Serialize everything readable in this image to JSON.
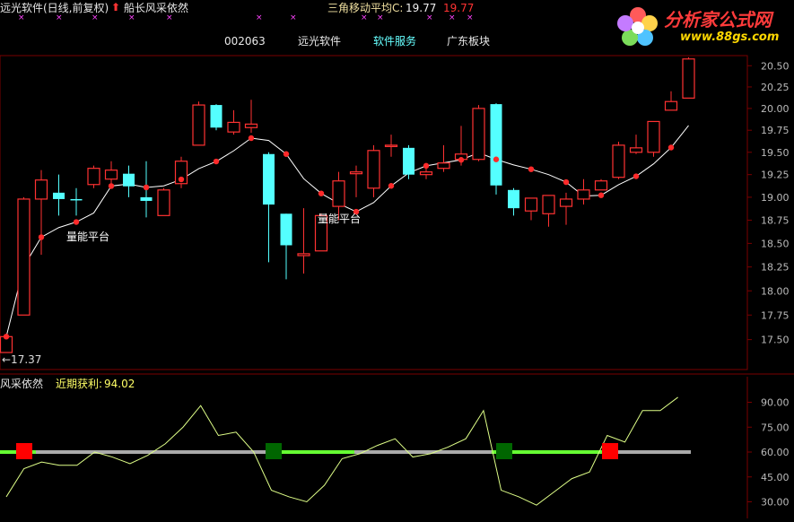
{
  "header": {
    "title": "远光软件(日线,前复权)",
    "indicator_arrow": "up-arrow-icon",
    "indicator": "船长风采依然",
    "tri_label": "三角移动平均C:",
    "tri_value": "19.77",
    "tri_value2": "19.77"
  },
  "info_bar": {
    "code": "002063",
    "name": "远光软件",
    "industry": "软件服务",
    "region": "广东板块"
  },
  "logo": {
    "text": "分析家公式网",
    "url": "www.88gs.com"
  },
  "main_chart": {
    "low_marker": "←17.37",
    "platform_label": "量能平台",
    "y_ticks": [
      "20.50",
      "20.25",
      "20.00",
      "19.75",
      "19.50",
      "19.25",
      "19.00",
      "18.75",
      "18.50",
      "18.25",
      "18.00",
      "17.75",
      "17.50"
    ]
  },
  "sub_chart": {
    "title": "风采依然",
    "metric_label": "近期获利:",
    "metric_value": "94.02",
    "y_ticks": [
      "90.00",
      "75.00",
      "60.00",
      "45.00",
      "30.00"
    ]
  },
  "colors": {
    "up": "#ff3232",
    "down": "#54ffff",
    "ma": "#ffffff",
    "sub_line": "#dfff88",
    "baseline_green": "#66ff33",
    "baseline_gray": "#aaaaaa",
    "grid_red": "#7a0000"
  },
  "chart_data": [
    {
      "type": "candlestick",
      "y_scale": "log",
      "ylim": [
        17.2,
        20.62
      ],
      "candles": [
        {
          "o": 17.37,
          "h": 17.56,
          "l": 17.37,
          "c": 17.53
        },
        {
          "o": 17.75,
          "h": 19.0,
          "l": 17.75,
          "c": 18.98
        },
        {
          "o": 18.98,
          "h": 19.3,
          "l": 18.38,
          "c": 19.19
        },
        {
          "o": 19.05,
          "h": 19.25,
          "l": 18.8,
          "c": 18.98
        },
        {
          "o": 18.98,
          "h": 19.1,
          "l": 18.8,
          "c": 18.97
        },
        {
          "o": 19.14,
          "h": 19.35,
          "l": 19.1,
          "c": 19.32
        },
        {
          "o": 19.2,
          "h": 19.4,
          "l": 19.1,
          "c": 19.3
        },
        {
          "o": 19.26,
          "h": 19.35,
          "l": 19.0,
          "c": 19.12
        },
        {
          "o": 19.0,
          "h": 19.4,
          "l": 18.78,
          "c": 18.96
        },
        {
          "o": 18.8,
          "h": 19.1,
          "l": 18.8,
          "c": 19.08
        },
        {
          "o": 19.15,
          "h": 19.45,
          "l": 19.1,
          "c": 19.4
        },
        {
          "o": 19.58,
          "h": 20.08,
          "l": 19.58,
          "c": 20.04
        },
        {
          "o": 20.04,
          "h": 20.05,
          "l": 19.75,
          "c": 19.78
        },
        {
          "o": 19.73,
          "h": 19.98,
          "l": 19.7,
          "c": 19.84
        },
        {
          "o": 19.78,
          "h": 20.1,
          "l": 19.72,
          "c": 19.82
        },
        {
          "o": 19.48,
          "h": 19.5,
          "l": 18.3,
          "c": 18.92
        },
        {
          "o": 18.82,
          "h": 18.82,
          "l": 18.12,
          "c": 18.48
        },
        {
          "o": 18.37,
          "h": 18.88,
          "l": 18.18,
          "c": 18.39
        },
        {
          "o": 18.42,
          "h": 18.82,
          "l": 18.42,
          "c": 18.8
        },
        {
          "o": 18.9,
          "h": 19.28,
          "l": 18.75,
          "c": 19.18
        },
        {
          "o": 19.26,
          "h": 19.35,
          "l": 19.0,
          "c": 19.28
        },
        {
          "o": 19.1,
          "h": 19.58,
          "l": 19.0,
          "c": 19.52
        },
        {
          "o": 19.58,
          "h": 19.7,
          "l": 19.45,
          "c": 19.58
        },
        {
          "o": 19.55,
          "h": 19.58,
          "l": 19.2,
          "c": 19.25
        },
        {
          "o": 19.25,
          "h": 19.35,
          "l": 19.2,
          "c": 19.28
        },
        {
          "o": 19.32,
          "h": 19.58,
          "l": 19.28,
          "c": 19.38
        },
        {
          "o": 19.42,
          "h": 19.8,
          "l": 19.35,
          "c": 19.48
        },
        {
          "o": 19.42,
          "h": 20.04,
          "l": 19.4,
          "c": 20.0
        },
        {
          "o": 20.05,
          "h": 20.06,
          "l": 19.03,
          "c": 19.13
        },
        {
          "o": 19.08,
          "h": 19.1,
          "l": 18.8,
          "c": 18.88
        },
        {
          "o": 18.85,
          "h": 18.95,
          "l": 18.75,
          "c": 18.99
        },
        {
          "o": 18.82,
          "h": 19.0,
          "l": 18.68,
          "c": 19.02
        },
        {
          "o": 18.9,
          "h": 19.05,
          "l": 18.7,
          "c": 18.98
        },
        {
          "o": 18.98,
          "h": 19.2,
          "l": 18.92,
          "c": 19.08
        },
        {
          "o": 19.08,
          "h": 19.2,
          "l": 19.08,
          "c": 19.18
        },
        {
          "o": 19.22,
          "h": 19.62,
          "l": 19.2,
          "c": 19.58
        },
        {
          "o": 19.5,
          "h": 19.7,
          "l": 19.48,
          "c": 19.55
        },
        {
          "o": 19.5,
          "h": 19.85,
          "l": 19.45,
          "c": 19.85
        },
        {
          "o": 19.98,
          "h": 20.2,
          "l": 19.98,
          "c": 20.08
        },
        {
          "o": 20.12,
          "h": 20.6,
          "l": 20.12,
          "c": 20.58
        }
      ]
    },
    {
      "type": "line",
      "name": "风采依然",
      "ylim": [
        20,
        100
      ],
      "values": [
        33,
        50,
        54,
        52,
        52,
        60,
        57,
        53,
        58,
        65,
        75,
        88,
        70,
        72,
        60,
        37,
        33,
        30,
        40,
        56,
        59,
        64,
        68,
        57,
        59,
        63,
        68,
        85,
        37,
        33,
        28,
        36,
        44,
        48,
        70,
        66,
        85,
        85,
        93
      ]
    }
  ]
}
